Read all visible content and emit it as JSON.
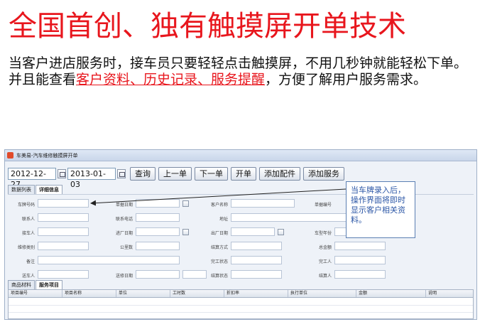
{
  "slide": {
    "title": "全国首创、独有触摸屏开单技术",
    "line1": "当客户进店服务时，接车员只要轻轻点击触摸屏，不用几秒钟就能轻松下单。",
    "line2_prefix": "并且能查看",
    "line2_highlight": "客户资料、历史记录、服务提醒",
    "line2_suffix": "，方便了解用户服务需求。",
    "highlight_color": "#e8161d"
  },
  "app": {
    "window_title": "车美易-汽车维修触摸屏开单",
    "toolbar": {
      "start_date": "2012-12-27",
      "end_date": "2013-01-03",
      "buttons": [
        "查询",
        "上一单",
        "下一单",
        "开单",
        "添加配件",
        "添加服务"
      ]
    },
    "tabs_top": [
      "数据列表",
      "详细信息"
    ],
    "form_labels": {
      "plate": "车牌号码",
      "order_date": "单据日期",
      "customer_name": "客户名称",
      "order_no": "单据编号",
      "contact": "联系人",
      "contact_phone": "联系电话",
      "address": "地址",
      "receiver": "接车人",
      "in_date": "进厂日期",
      "out_date": "出厂日期",
      "car_year": "车型年份",
      "repair_type": "维修类别",
      "mileage": "公里数",
      "settle_method": "结算方式",
      "total_amount": "总金额",
      "remark": "备注",
      "finish_status": "完工状态",
      "finisher": "完工人",
      "sender": "送车人",
      "send_date": "送修日期",
      "settle_status": "结算状态",
      "settler": "结算人"
    },
    "tabs_bottom": [
      "商品材料",
      "服务项目"
    ],
    "grid_columns": [
      "项目编号",
      "项目名称",
      "单位",
      "工时数",
      "折扣率",
      "执行单位",
      "金额",
      "说明"
    ]
  },
  "callout": {
    "text": "当车牌录入后，操作界面将即时显示客户相关资料。"
  }
}
